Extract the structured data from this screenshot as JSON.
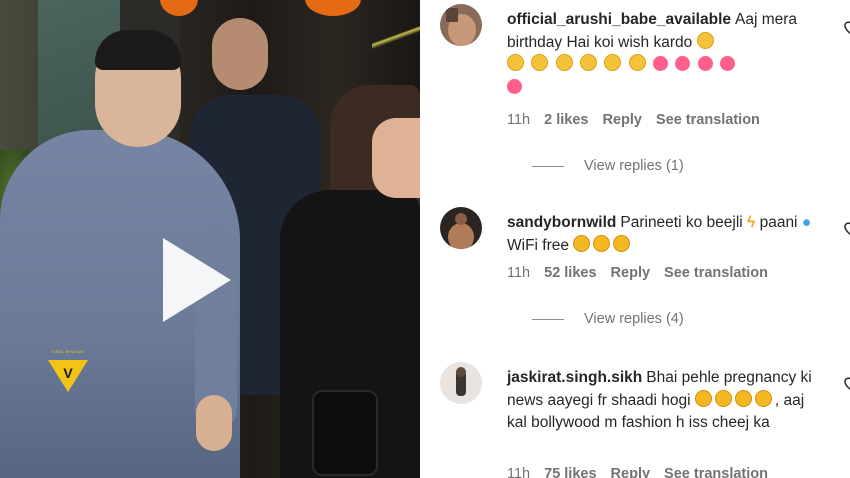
{
  "video": {
    "watermark": "VIRAL BHAYANI",
    "play_icon": "play-icon"
  },
  "comments": [
    {
      "username": "official_arushi_babe_available",
      "text": "Aaj mera birthday Hai koi wish kardo",
      "emojis": "🥺 🥺 🥺 🥺 🥺 🥺 🥰 🥰 🥰 🥰 🥰 🥰",
      "time": "11h",
      "likes": "2 likes",
      "reply": "Reply",
      "translate": "See translation",
      "view_replies": "View replies (1)"
    },
    {
      "username": "sandybornwild",
      "text": "Parineeti ko beejli",
      "text2": "paani",
      "text3": "WiFi free",
      "time": "11h",
      "likes": "52 likes",
      "reply": "Reply",
      "translate": "See translation",
      "view_replies": "View replies (4)"
    },
    {
      "username": "jaskirat.singh.sikh",
      "text": "Bhai pehle pregnancy ki news aayegi fr shaadi hogi",
      "text2": ", aaj kal bollywood m fashion h iss cheej ka",
      "time": "11h",
      "likes": "75 likes",
      "reply": "Reply",
      "translate": "See translation"
    }
  ],
  "colors": {
    "text": "#262626",
    "muted": "#737373",
    "background": "#ffffff"
  }
}
